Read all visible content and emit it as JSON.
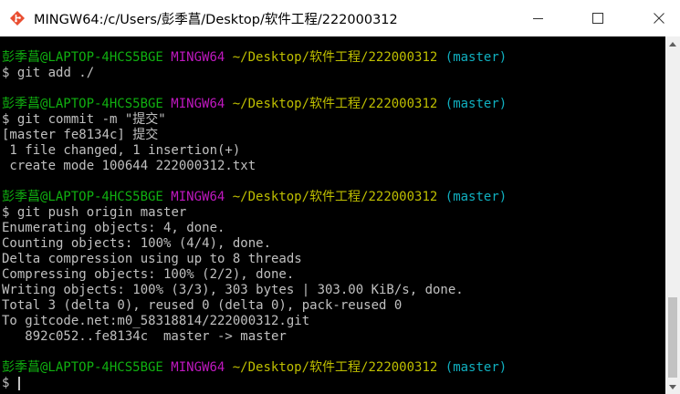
{
  "window": {
    "title": "MINGW64:/c/Users/彭季菖/Desktop/软件工程/222000312",
    "app_icon": "git-bash-icon",
    "controls": [
      "minimize-icon",
      "maximize-icon",
      "close-icon"
    ]
  },
  "prompt": {
    "user_host": "彭季菖@LAPTOP-4HCS5BGE",
    "system": "MINGW64",
    "path": "~/Desktop/软件工程/222000312",
    "branch": "(master)",
    "symbol": "$"
  },
  "colors": {
    "user_host": "#10b010",
    "system": "#c018c0",
    "path": "#bfbf00",
    "branch": "#10b0c0",
    "output": "#c0c0c0",
    "background": "#000000"
  },
  "session": [
    {
      "command": "git add ./",
      "output": []
    },
    {
      "command": "git commit -m \"提交\"",
      "output": [
        "[master fe8134c] 提交",
        " 1 file changed, 1 insertion(+)",
        " create mode 100644 222000312.txt"
      ]
    },
    {
      "command": "git push origin master",
      "output": [
        "Enumerating objects: 4, done.",
        "Counting objects: 100% (4/4), done.",
        "Delta compression using up to 8 threads",
        "Compressing objects: 100% (2/2), done.",
        "Writing objects: 100% (3/3), 303 bytes | 303.00 KiB/s, done.",
        "Total 3 (delta 0), reused 0 (delta 0), pack-reused 0",
        "To gitcode.net:m0_58318814/222000312.git",
        "   892c052..fe8134c  master -> master"
      ]
    }
  ],
  "current_input": ""
}
